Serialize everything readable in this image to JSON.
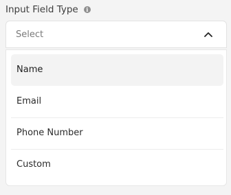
{
  "field": {
    "label": "Input Field Type",
    "info_icon": "info-icon"
  },
  "select": {
    "placeholder": "Select",
    "expanded": true,
    "chevron_icon": "chevron-up-icon"
  },
  "options": [
    {
      "label": "Name",
      "selected": true
    },
    {
      "label": "Email",
      "selected": false
    },
    {
      "label": "Phone Number",
      "selected": false
    },
    {
      "label": "Custom",
      "selected": false
    }
  ]
}
